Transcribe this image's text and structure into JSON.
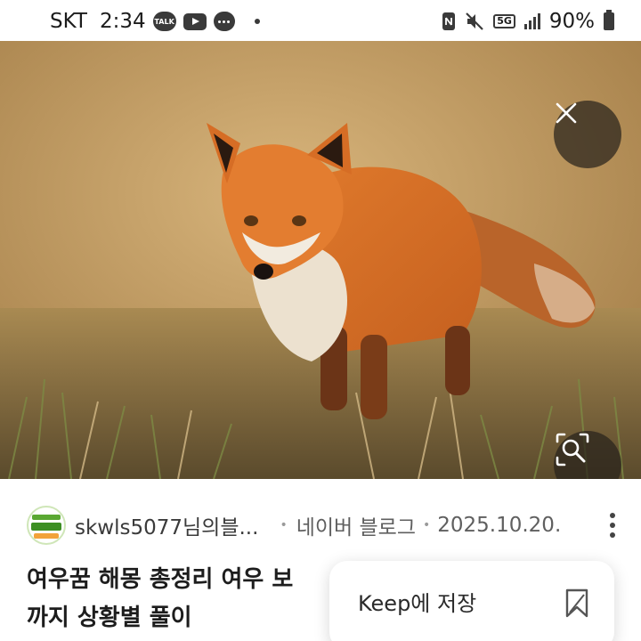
{
  "status_bar": {
    "carrier": "SKT",
    "time": "2:34",
    "talk_badge": "TALK",
    "network": "5G",
    "battery_percent": "90%",
    "icons": [
      "kakaotalk-icon",
      "youtube-icon",
      "chat-bubble-icon",
      "notification-dot-icon",
      "nfc-icon",
      "mute-icon",
      "network-5g-icon",
      "signal-icon",
      "battery-icon"
    ]
  },
  "hero": {
    "subject_icon": "fox-photo",
    "close_icon": "close-icon",
    "lens_icon": "image-search-icon"
  },
  "article": {
    "blog_name": "skwls5077님의블...",
    "separator": "•",
    "source": "네이버 블로그",
    "date": "2025.10.20.",
    "title_line1": "여우꿈 해몽 총정리 여우 보",
    "title_line2": "까지 상황별 풀이"
  },
  "keep_popup": {
    "label": "Keep에 저장",
    "icon": "bookmark-icon"
  },
  "colors": {
    "overlay_button": "#28221c",
    "text_primary": "#1d1d1d",
    "text_secondary": "#5f5f5f"
  }
}
